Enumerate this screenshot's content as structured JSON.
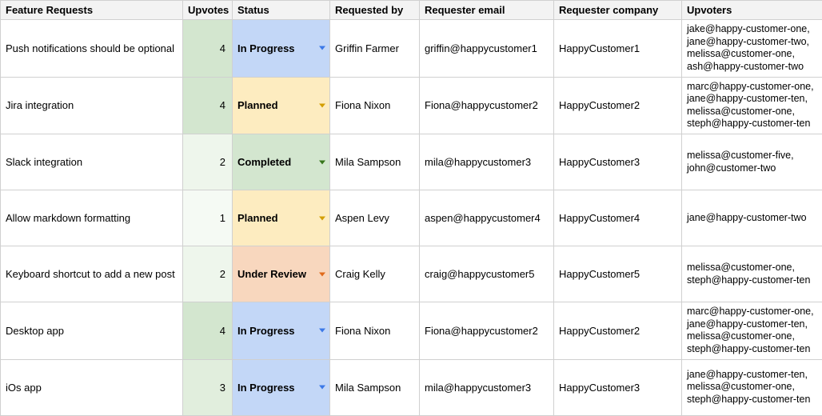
{
  "headers": {
    "feature": "Feature Requests",
    "upvotes": "Upvotes",
    "status": "Status",
    "requested_by": "Requested by",
    "requester_email": "Requester email",
    "requester_company": "Requester company",
    "upvoters": "Upvoters"
  },
  "status_styles": {
    "In Progress": {
      "bg": "#c3d7f7",
      "caret": "#3b78e7"
    },
    "Planned": {
      "bg": "#fdecc0",
      "caret": "#d39e00"
    },
    "Completed": {
      "bg": "#d3e6cf",
      "caret": "#38761d"
    },
    "Under Review": {
      "bg": "#f8d7be",
      "caret": "#e06a1b"
    }
  },
  "upvote_scale": {
    "1": "#f5faf4",
    "2": "#eef6ec",
    "3": "#e1eedd",
    "4": "#d3e6cf"
  },
  "rows": [
    {
      "feature": "Push notifications should be optional",
      "upvotes": 4,
      "status": "In Progress",
      "requested_by": "Griffin Farmer",
      "requester_email": "griffin@happycustomer1",
      "requester_company": "HappyCustomer1",
      "upvoters": "jake@happy-customer-one, jane@happy-customer-two, melissa@customer-one, ash@happy-customer-two"
    },
    {
      "feature": "Jira integration",
      "upvotes": 4,
      "status": "Planned",
      "requested_by": "Fiona Nixon",
      "requester_email": "Fiona@happycustomer2",
      "requester_company": "HappyCustomer2",
      "upvoters": "marc@happy-customer-one, jane@happy-customer-ten, melissa@customer-one, steph@happy-customer-ten"
    },
    {
      "feature": "Slack integration",
      "upvotes": 2,
      "status": "Completed",
      "requested_by": "Mila Sampson",
      "requester_email": "mila@happycustomer3",
      "requester_company": "HappyCustomer3",
      "upvoters": "melissa@customer-five, john@customer-two"
    },
    {
      "feature": "Allow markdown formatting",
      "upvotes": 1,
      "status": "Planned",
      "requested_by": "Aspen Levy",
      "requester_email": "aspen@happycustomer4",
      "requester_company": "HappyCustomer4",
      "upvoters": "jane@happy-customer-two"
    },
    {
      "feature": "Keyboard shortcut to add a new post",
      "upvotes": 2,
      "status": "Under Review",
      "requested_by": "Craig Kelly",
      "requester_email": "craig@happycustomer5",
      "requester_company": "HappyCustomer5",
      "upvoters": "melissa@customer-one, steph@happy-customer-ten"
    },
    {
      "feature": "Desktop app",
      "upvotes": 4,
      "status": "In Progress",
      "requested_by": "Fiona Nixon",
      "requester_email": "Fiona@happycustomer2",
      "requester_company": "HappyCustomer2",
      "upvoters": "marc@happy-customer-one, jane@happy-customer-ten, melissa@customer-one, steph@happy-customer-ten"
    },
    {
      "feature": "iOs app",
      "upvotes": 3,
      "status": "In Progress",
      "requested_by": "Mila Sampson",
      "requester_email": "mila@happycustomer3",
      "requester_company": "HappyCustomer3",
      "upvoters": "jane@happy-customer-ten, melissa@customer-one, steph@happy-customer-ten"
    }
  ]
}
